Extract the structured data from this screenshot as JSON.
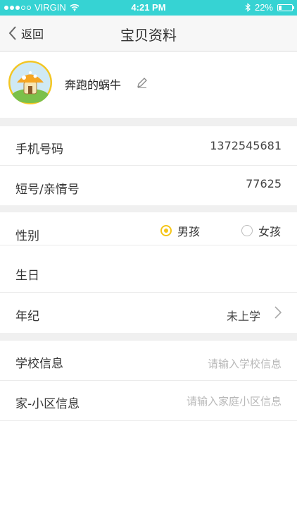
{
  "status_bar": {
    "carrier": "VIRGIN",
    "time": "4:21 PM",
    "battery": "22%",
    "battery_level": 0.22
  },
  "nav": {
    "back_label": "返回",
    "title": "宝贝资料"
  },
  "profile": {
    "nickname": "奔跑的蜗牛"
  },
  "fields": {
    "phone": {
      "label": "手机号码",
      "value": "1372545681"
    },
    "short_number": {
      "label": "短号/亲情号",
      "value": "77625"
    },
    "gender": {
      "label": "性别",
      "options": [
        "男孩",
        "女孩"
      ],
      "selected": "男孩"
    },
    "birthday": {
      "label": "生日",
      "value": ""
    },
    "grade": {
      "label": "年纪",
      "value": "未上学"
    },
    "school": {
      "label": "学校信息",
      "placeholder": "请输入学校信息"
    },
    "community": {
      "label": "家-小区信息",
      "placeholder": "请输入家庭小区信息"
    }
  },
  "colors": {
    "status_bar": "#36d3d3",
    "accent": "#f5c518"
  }
}
